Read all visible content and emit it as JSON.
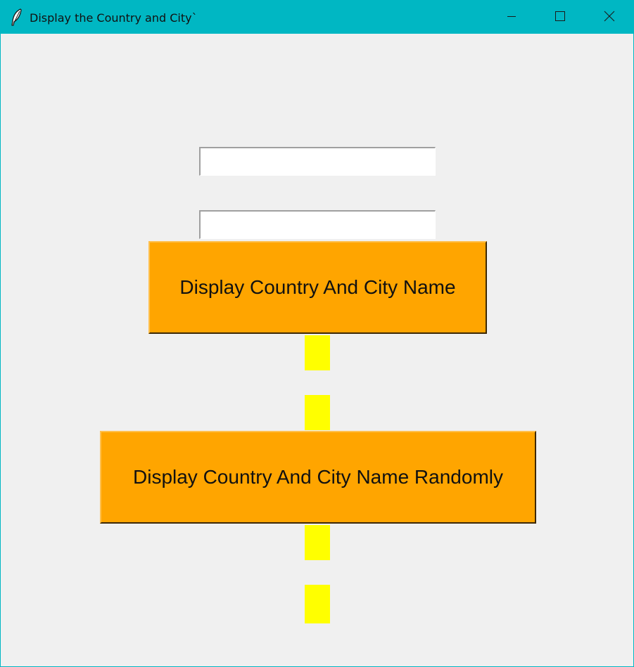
{
  "window": {
    "title": "Display the Country and City`",
    "icon": "feather-icon",
    "controls": {
      "minimize_icon": "minimize-icon",
      "maximize_icon": "maximize-icon",
      "close_icon": "close-icon"
    }
  },
  "form": {
    "country_field": {
      "value": "",
      "placeholder": ""
    },
    "city_field": {
      "value": "",
      "placeholder": ""
    },
    "display_button_label": "Display Country And City Name",
    "random_button_label": "Display Country And City Name Randomly"
  },
  "colors": {
    "titlebar": "#00b7c3",
    "background": "#f0f0f0",
    "button": "#ffa500",
    "label_block": "#ffff00"
  }
}
